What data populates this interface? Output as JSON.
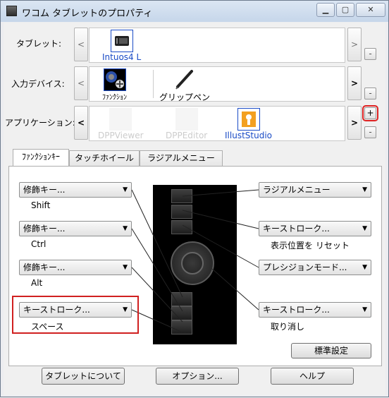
{
  "window": {
    "title": "ワコム タブレットのプロパティ",
    "minimize": "▁",
    "maximize": "▢",
    "close": "✕"
  },
  "tablet_row": {
    "label": "タブレット:",
    "items": [
      {
        "name": "Intuos4 L",
        "icon": "tablet-icon"
      }
    ],
    "prev": "<",
    "next": ">",
    "remove": "-"
  },
  "device_row": {
    "label": "入力デバイス:",
    "items": [
      {
        "name": "ﾌｧﾝｸｼｮﾝ",
        "icon": "function-keys-icon"
      },
      {
        "name": "グリップペン",
        "icon": "grip-pen-icon"
      }
    ],
    "prev": "<",
    "next": ">",
    "remove": "-"
  },
  "app_row": {
    "label": "アプリケーション:",
    "items": [
      {
        "name": "DPPViewer",
        "icon": "app-icon"
      },
      {
        "name": "DPPEditor",
        "icon": "app-icon"
      },
      {
        "name": "IllustStudio",
        "icon": "illuststudio-icon"
      }
    ],
    "prev": "<",
    "next": ">",
    "add": "+",
    "remove": "-"
  },
  "tabs": [
    {
      "label": "ﾌｧﾝｸｼｮﾝｷｰ"
    },
    {
      "label": "タッチホイール"
    },
    {
      "label": "ラジアルメニュー"
    }
  ],
  "left_keys": [
    {
      "value": "修飾キー...",
      "caption": "Shift"
    },
    {
      "value": "修飾キー...",
      "caption": "Ctrl"
    },
    {
      "value": "修飾キー...",
      "caption": "Alt"
    },
    {
      "value": "キーストローク...",
      "caption": "スペース"
    }
  ],
  "right_keys": [
    {
      "value": "ラジアルメニュー",
      "caption": ""
    },
    {
      "value": "キーストローク...",
      "caption": "表示位置を リセット"
    },
    {
      "value": "プレシジョンモード...",
      "caption": ""
    },
    {
      "value": "キーストローク...",
      "caption": "取り消し"
    }
  ],
  "default_button": "標準設定",
  "bottom_buttons": {
    "about": "タブレットについて",
    "options": "オプション...",
    "help": "ヘルプ"
  },
  "colors": {
    "highlight_red": "#d02020",
    "device_black": "#000000",
    "selection_blue": "#1a4bc6"
  }
}
